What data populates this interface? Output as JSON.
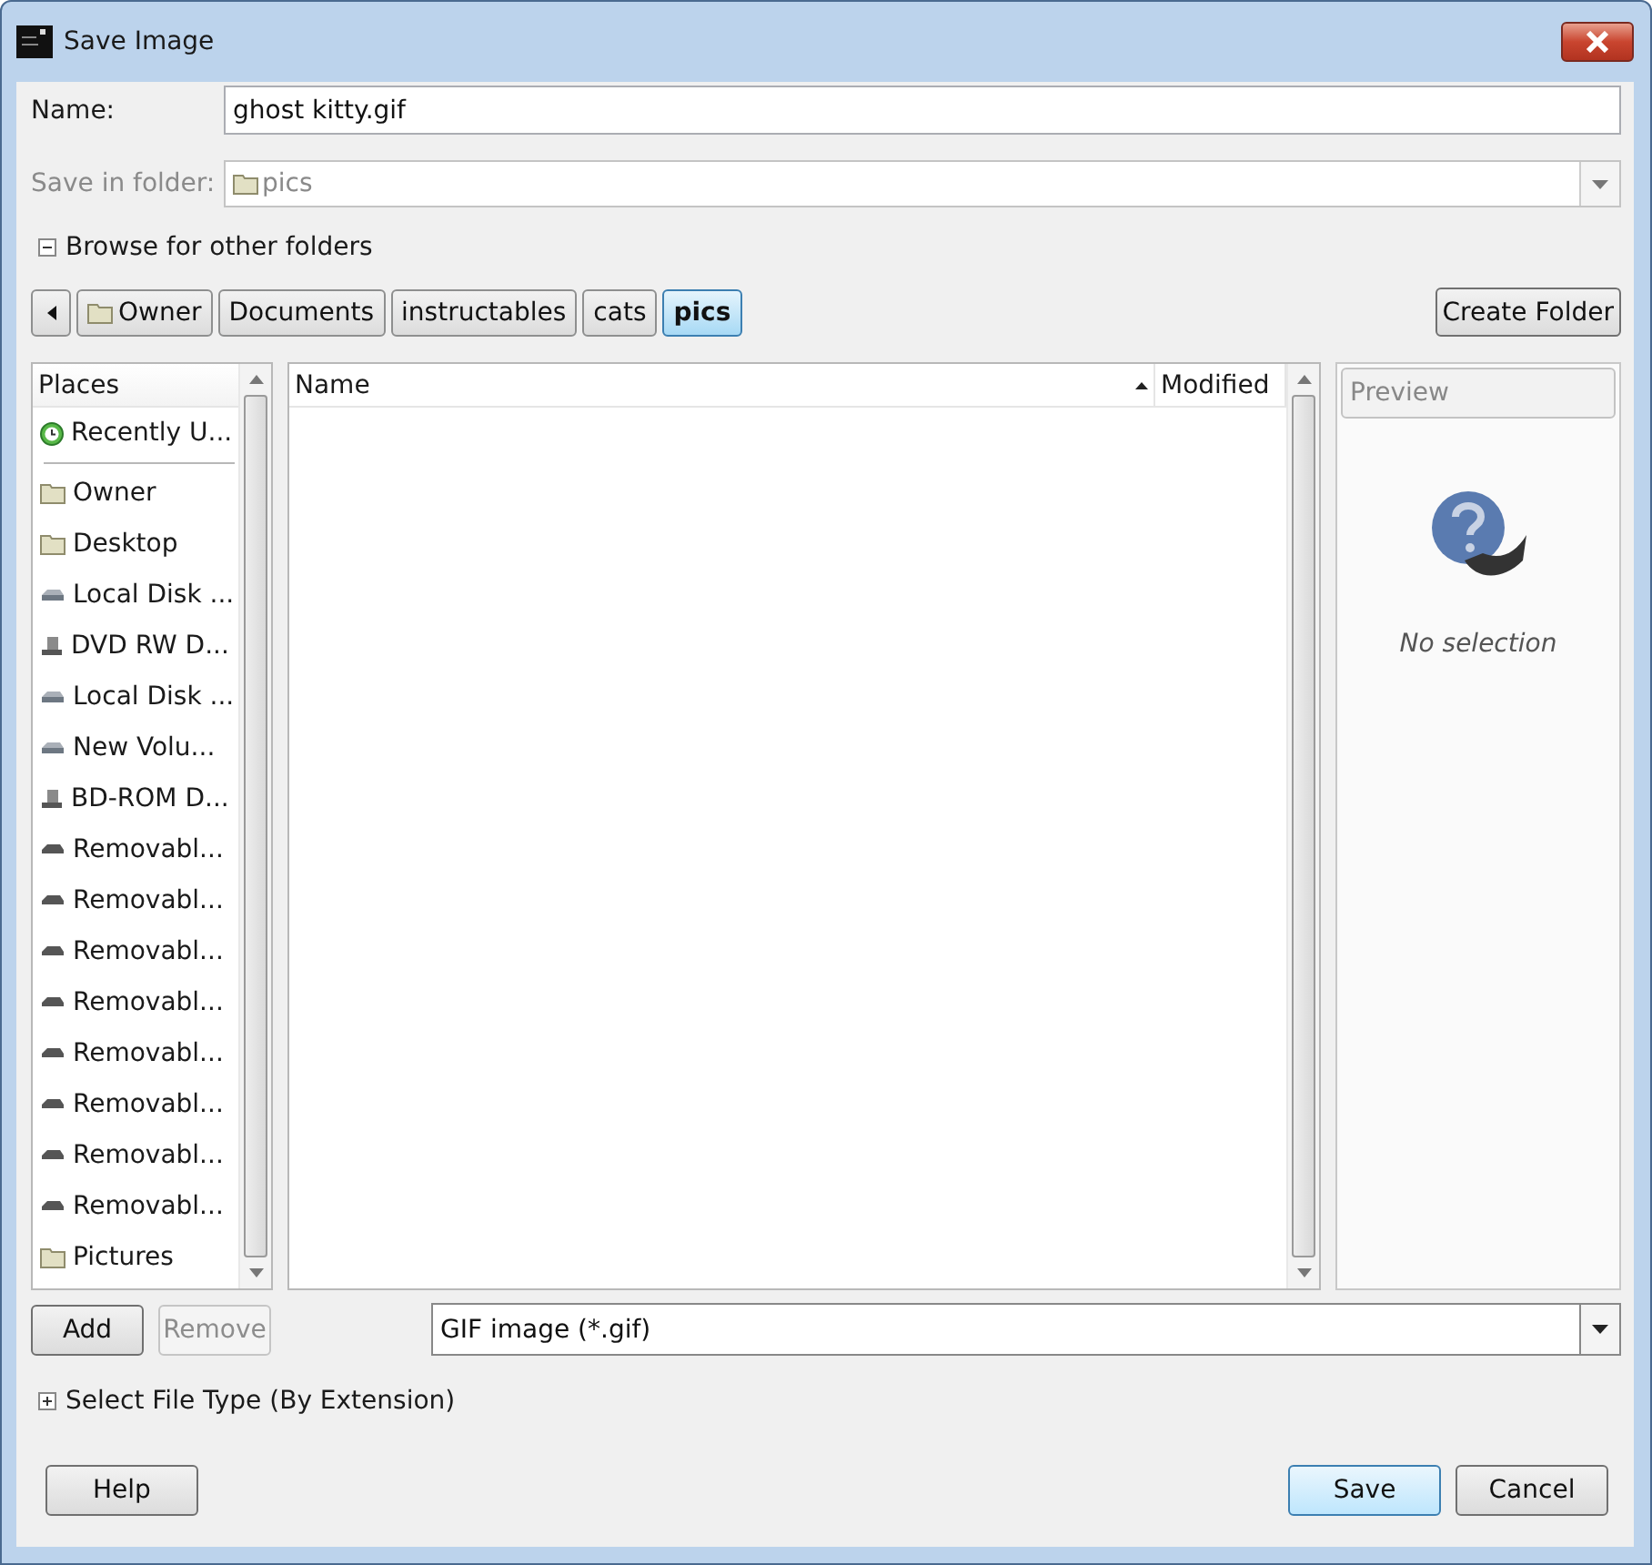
{
  "window": {
    "title": "Save Image"
  },
  "name_field": {
    "label": "Name:",
    "value": "ghost kitty.gif"
  },
  "folder_field": {
    "label": "Save in folder:",
    "value": "pics",
    "disabled": true
  },
  "browse_expander": {
    "label": "Browse for other folders",
    "expanded": true
  },
  "path_bar": [
    {
      "label": "Owner",
      "selected": false,
      "kind": "folder"
    },
    {
      "label": "Documents",
      "selected": false,
      "kind": "plain"
    },
    {
      "label": "instructables",
      "selected": false,
      "kind": "plain"
    },
    {
      "label": "cats",
      "selected": false,
      "kind": "plain"
    },
    {
      "label": "pics",
      "selected": true,
      "kind": "plain"
    }
  ],
  "create_folder_button": "Create Folder",
  "places": {
    "header": "Places",
    "items": [
      {
        "label": "Recently U...",
        "kind": "recent"
      },
      {
        "label": "Owner",
        "kind": "folder"
      },
      {
        "label": "Desktop",
        "kind": "folder"
      },
      {
        "label": "Local Disk ...",
        "kind": "disk"
      },
      {
        "label": "DVD RW D...",
        "kind": "optical"
      },
      {
        "label": "Local Disk ...",
        "kind": "disk"
      },
      {
        "label": "New Volu...",
        "kind": "disk"
      },
      {
        "label": "BD-ROM D...",
        "kind": "optical"
      },
      {
        "label": "Removabl...",
        "kind": "removable"
      },
      {
        "label": "Removabl...",
        "kind": "removable"
      },
      {
        "label": "Removabl...",
        "kind": "removable"
      },
      {
        "label": "Removabl...",
        "kind": "removable"
      },
      {
        "label": "Removabl...",
        "kind": "removable"
      },
      {
        "label": "Removabl...",
        "kind": "removable"
      },
      {
        "label": "Removabl...",
        "kind": "removable"
      },
      {
        "label": "Removabl...",
        "kind": "removable"
      },
      {
        "label": "Pictures",
        "kind": "folder"
      }
    ]
  },
  "file_list": {
    "columns": [
      "Name",
      "Modified"
    ]
  },
  "preview": {
    "title": "Preview",
    "message": "No selection"
  },
  "add_button": {
    "label": "Add",
    "disabled": false
  },
  "remove_button": {
    "label": "Remove",
    "disabled": true
  },
  "filter": {
    "value": "GIF image (*.gif)"
  },
  "file_type_expander": {
    "label": "Select File Type (By Extension)",
    "expanded": false
  },
  "buttons": [
    {
      "label": "Help",
      "selected": false
    },
    {
      "label": "Save",
      "selected": true
    },
    {
      "label": "Cancel",
      "selected": false
    }
  ]
}
